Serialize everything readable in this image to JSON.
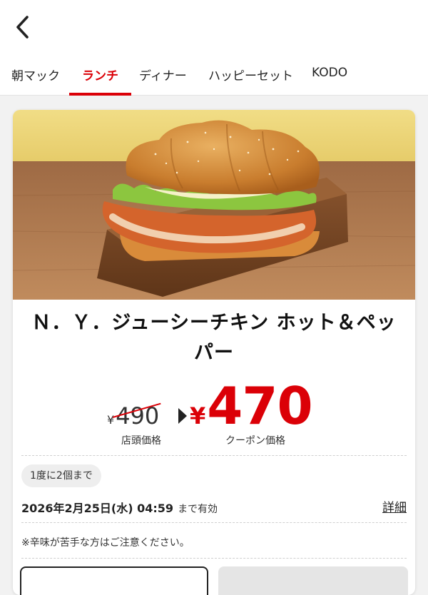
{
  "header": {
    "back_icon": "chevron-left-icon"
  },
  "tabs": [
    {
      "label": "朝マック"
    },
    {
      "label": "ランチ"
    },
    {
      "label": "ディナー"
    },
    {
      "label": "ハッピーセット"
    },
    {
      "label": "KODO"
    }
  ],
  "active_tab": "ランチ",
  "colors": {
    "accent": "#db0007",
    "wall": "#ecd67a",
    "wood": "#b27a4d"
  },
  "coupon": {
    "title": "Ｎ．Ｙ．ジューシーチキン ホット＆ペッパー",
    "regular_price": {
      "yen": "¥",
      "value": "490",
      "label": "店頭価格"
    },
    "coupon_price": {
      "yen": "¥",
      "value": "470",
      "label": "クーポン価格"
    },
    "limit": "1度に2個まで",
    "expiry": {
      "date": "2026年2月25日(水) 04:59",
      "suffix": "まで有効"
    },
    "details_link": "詳細",
    "note": "※辛味が苦手な方はご注意ください。"
  }
}
